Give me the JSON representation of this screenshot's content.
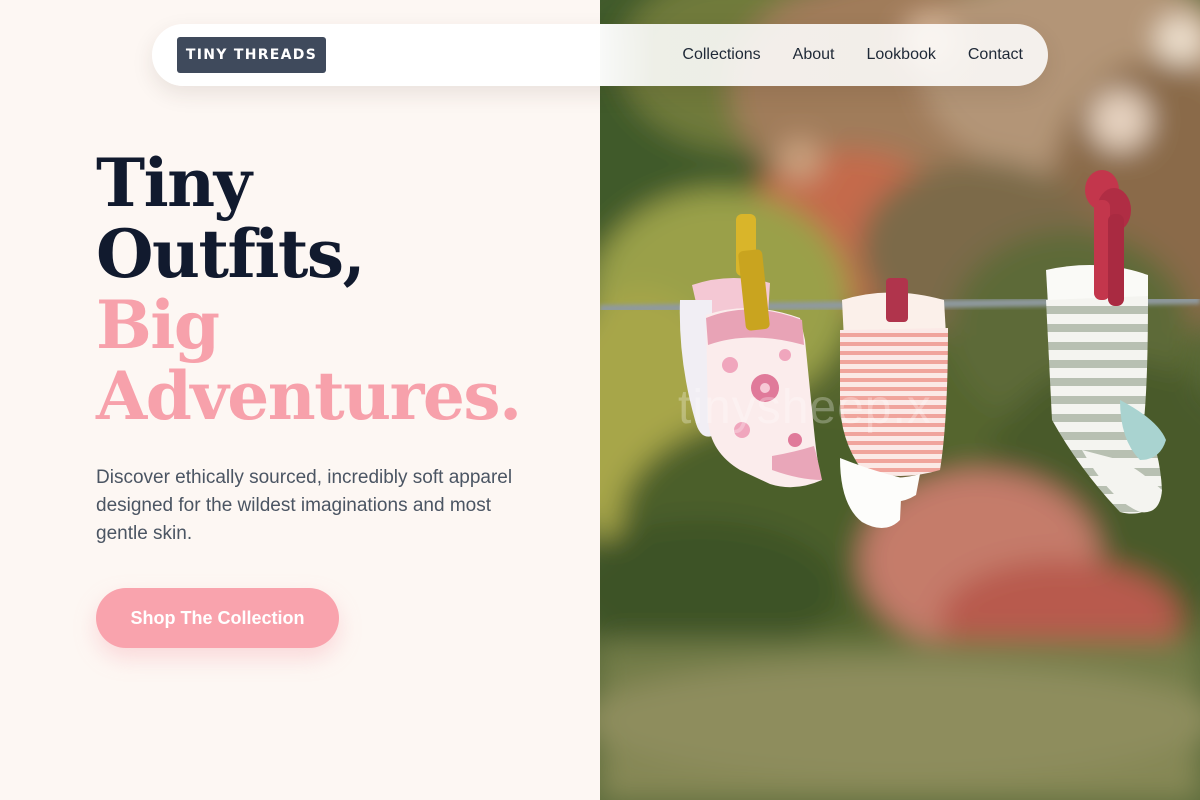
{
  "brand": {
    "logo_text": "TINY THREADS"
  },
  "nav": {
    "links": [
      {
        "label": "Collections"
      },
      {
        "label": "About"
      },
      {
        "label": "Lookbook"
      },
      {
        "label": "Contact"
      }
    ]
  },
  "hero": {
    "headline_dark": [
      "Tiny",
      "Outfits,"
    ],
    "headline_pink": [
      "Big",
      "Adventures."
    ],
    "description": "Discover ethically sourced, incredibly soft apparel designed for the wildest imaginations and most gentle skin.",
    "cta_label": "Shop The Collection"
  },
  "photo": {
    "subject": "baby socks hanging on a clothesline with clothespins",
    "watermark_text": "tinysheep.x"
  },
  "colors": {
    "background": "#fdf7f3",
    "dark_text": "#111a2e",
    "accent_pink": "#f7a1ab",
    "logo_bg": "#3f4a5c",
    "body_text": "#4b5563"
  }
}
